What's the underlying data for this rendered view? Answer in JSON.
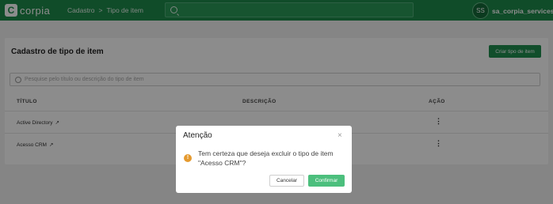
{
  "app": {
    "logo_mark": "C",
    "logo_text": "corpia"
  },
  "breadcrumb": {
    "items": [
      "Cadastro",
      "Tipo de item"
    ],
    "separator": ">"
  },
  "user": {
    "initials": "SS",
    "name": "sa_corpia_services"
  },
  "page": {
    "title": "Cadastro de tipo de item",
    "create_label": "Criar tipo de item",
    "filter_placeholder": "Pesquise pelo título ou descrição do tipo de item"
  },
  "table": {
    "headers": [
      "TÍTULO",
      "DESCRIÇÃO",
      "AÇÃO"
    ],
    "rows": [
      {
        "title": "Active Directory",
        "description": ""
      },
      {
        "title": "Acesso CRM",
        "description": ""
      }
    ],
    "external_link_glyph": "↗",
    "action_glyph": "⋮"
  },
  "dialog": {
    "title": "Atenção",
    "close_glyph": "×",
    "warn_glyph": "!",
    "message": "Tem certeza que deseja excluir o tipo de item \"Acesso CRM\"?",
    "cancel_label": "Cancelar",
    "confirm_label": "Confirmar"
  },
  "colors": {
    "brand": "#1e8a4c",
    "confirm": "#4cbf7d",
    "warning": "#e59a2f"
  }
}
